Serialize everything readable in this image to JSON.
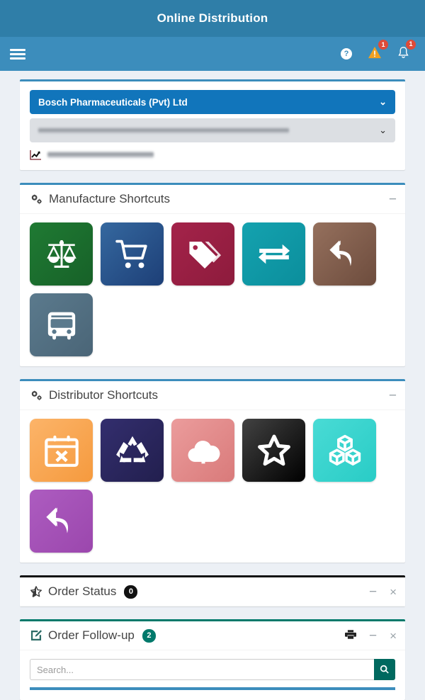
{
  "header": {
    "title": "Online Distribution",
    "menu_icon": "hamburger-icon",
    "help_icon": "question-circle-icon",
    "warning_icon": "warning-triangle-icon",
    "warning_badge": "1",
    "bell_icon": "bell-icon",
    "bell_badge": "1",
    "titlebar_color": "#2f7ea8",
    "toolbar_color": "#3c8dbc",
    "badge_color": "#dd4b39"
  },
  "company_panel": {
    "selected_company": "Bosch Pharmaceuticals (Pvt) Ltd",
    "company_caret": "⌄",
    "secondary_select_value": "",
    "secondary_caret": "⌄",
    "report_link_label": "",
    "report_link_icon": "chart-line-icon",
    "accent_color": "#3c8dbc",
    "select_color": "#1175bb"
  },
  "manufacture": {
    "title": "Manufacture Shortcuts",
    "icon": "cogs-icon",
    "collapse_label": "−",
    "accent_color": "#3c8dbc",
    "tiles": [
      {
        "name": "balance-scale-icon",
        "color_from": "#1f7a33",
        "color_to": "#186228"
      },
      {
        "name": "shopping-cart-icon",
        "color_from": "#2f5f9e",
        "color_to": "#1d3f77"
      },
      {
        "name": "tags-icon",
        "color_from": "#9e1f44",
        "color_to": "#8d1b3c"
      },
      {
        "name": "exchange-arrows-icon",
        "color_from": "#119aa8",
        "color_to": "#0b8e9c"
      },
      {
        "name": "reply-all-icon",
        "color_from": "#8a6352",
        "color_to": "#6d4c3d"
      },
      {
        "name": "bus-icon",
        "color_from": "#557386",
        "color_to": "#4a6577"
      }
    ]
  },
  "distributor": {
    "title": "Distributor Shortcuts",
    "icon": "cogs-icon",
    "collapse_label": "−",
    "accent_color": "#3c8dbc",
    "tiles": [
      {
        "name": "calendar-times-icon",
        "color_from": "#fbae5c",
        "color_to": "#f59a3e"
      },
      {
        "name": "recycle-icon",
        "color_from": "#2e2a63",
        "color_to": "#221f4e"
      },
      {
        "name": "cloud-upload-icon",
        "color_from": "#e79292",
        "color_to": "#d97a7a"
      },
      {
        "name": "star-outline-icon",
        "color_from": "#3a3a3a",
        "color_to": "#000000"
      },
      {
        "name": "cubes-icon",
        "color_from": "#3fd6d0",
        "color_to": "#29ccc6"
      },
      {
        "name": "reply-all-icon",
        "color_from": "#a855ba",
        "color_to": "#9b47ad"
      }
    ]
  },
  "order_status": {
    "title": "Order Status",
    "icon": "half-star-icon",
    "badge": "0",
    "collapse_label": "−",
    "close_label": "×",
    "accent_color": "#111111",
    "badge_color": "#111111"
  },
  "order_followup": {
    "title": "Order Follow-up",
    "icon": "edit-square-icon",
    "badge": "2",
    "print_icon": "print-icon",
    "collapse_label": "−",
    "close_label": "×",
    "accent_color": "#00796b",
    "badge_color": "#00796b",
    "search": {
      "placeholder": "Search...",
      "value": "",
      "button_icon": "search-icon",
      "button_color": "#00695f"
    }
  }
}
